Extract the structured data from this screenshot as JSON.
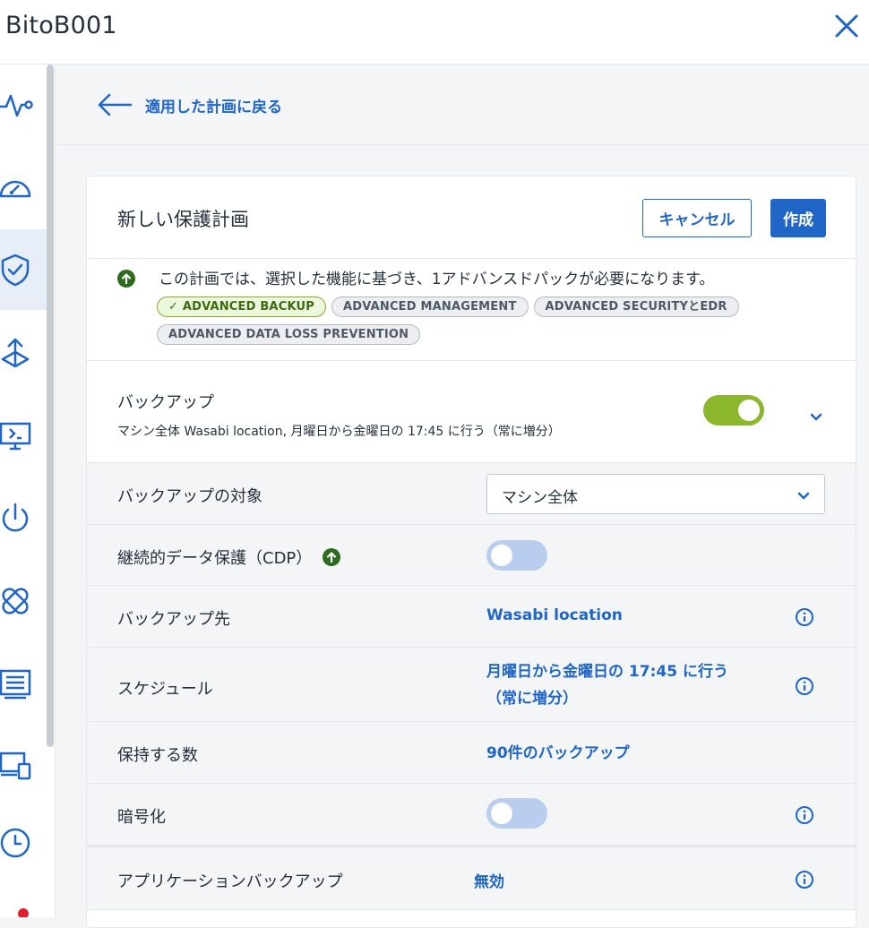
{
  "window": {
    "title": "BitoB001"
  },
  "sidebar": {
    "items": [
      {
        "icon": "activity-icon"
      },
      {
        "icon": "dashboard-gauge-icon"
      },
      {
        "icon": "shield-check-icon"
      },
      {
        "icon": "software-management-icon"
      },
      {
        "icon": "remote-desktop-icon"
      },
      {
        "icon": "power-icon"
      },
      {
        "icon": "patch-bandage-icon"
      },
      {
        "icon": "inventory-list-icon"
      },
      {
        "icon": "devices-icon"
      },
      {
        "icon": "history-clock-icon"
      }
    ],
    "notification_color": "#e0202f"
  },
  "back_link": {
    "label": "適用した計画に戻る"
  },
  "plan": {
    "title": "新しい保護計画",
    "cancel_label": "キャンセル",
    "create_label": "作成",
    "notice": "この計画では、選択した機能に基づき、1アドバンスドパックが必要になります。",
    "badges": [
      {
        "label": "✓ ADVANCED BACKUP",
        "active": true
      },
      {
        "label": "ADVANCED MANAGEMENT",
        "active": false
      },
      {
        "label": "ADVANCED SECURITYとEDR",
        "active": false
      },
      {
        "label": "ADVANCED DATA LOSS PREVENTION",
        "active": false
      }
    ],
    "backup": {
      "name": "バックアップ",
      "summary": "マシン全体 Wasabi location, 月曜日から金曜日の 17:45 に行う（常に増分）",
      "enabled": true
    },
    "rows": {
      "target": {
        "label": "バックアップの対象",
        "value": "マシン全体"
      },
      "cdp": {
        "label": "継続的データ保護（CDP）",
        "enabled": false
      },
      "destination": {
        "label": "バックアップ先",
        "value": "Wasabi location"
      },
      "schedule": {
        "label": "スケジュール",
        "value_line1": "月曜日から金曜日の 17:45 に行う",
        "value_line2": "（常に増分）"
      },
      "retention": {
        "label": "保持する数",
        "value": "90件のバックアップ"
      },
      "encryption": {
        "label": "暗号化",
        "enabled": false
      },
      "app_backup": {
        "label": "アプリケーションバックアップ",
        "value": "無効"
      }
    }
  },
  "colors": {
    "accent": "#1f66c7",
    "toggle_on": "#8bb72d",
    "toggle_off": "#b9cdee",
    "upgrade": "#2e6b1f"
  }
}
